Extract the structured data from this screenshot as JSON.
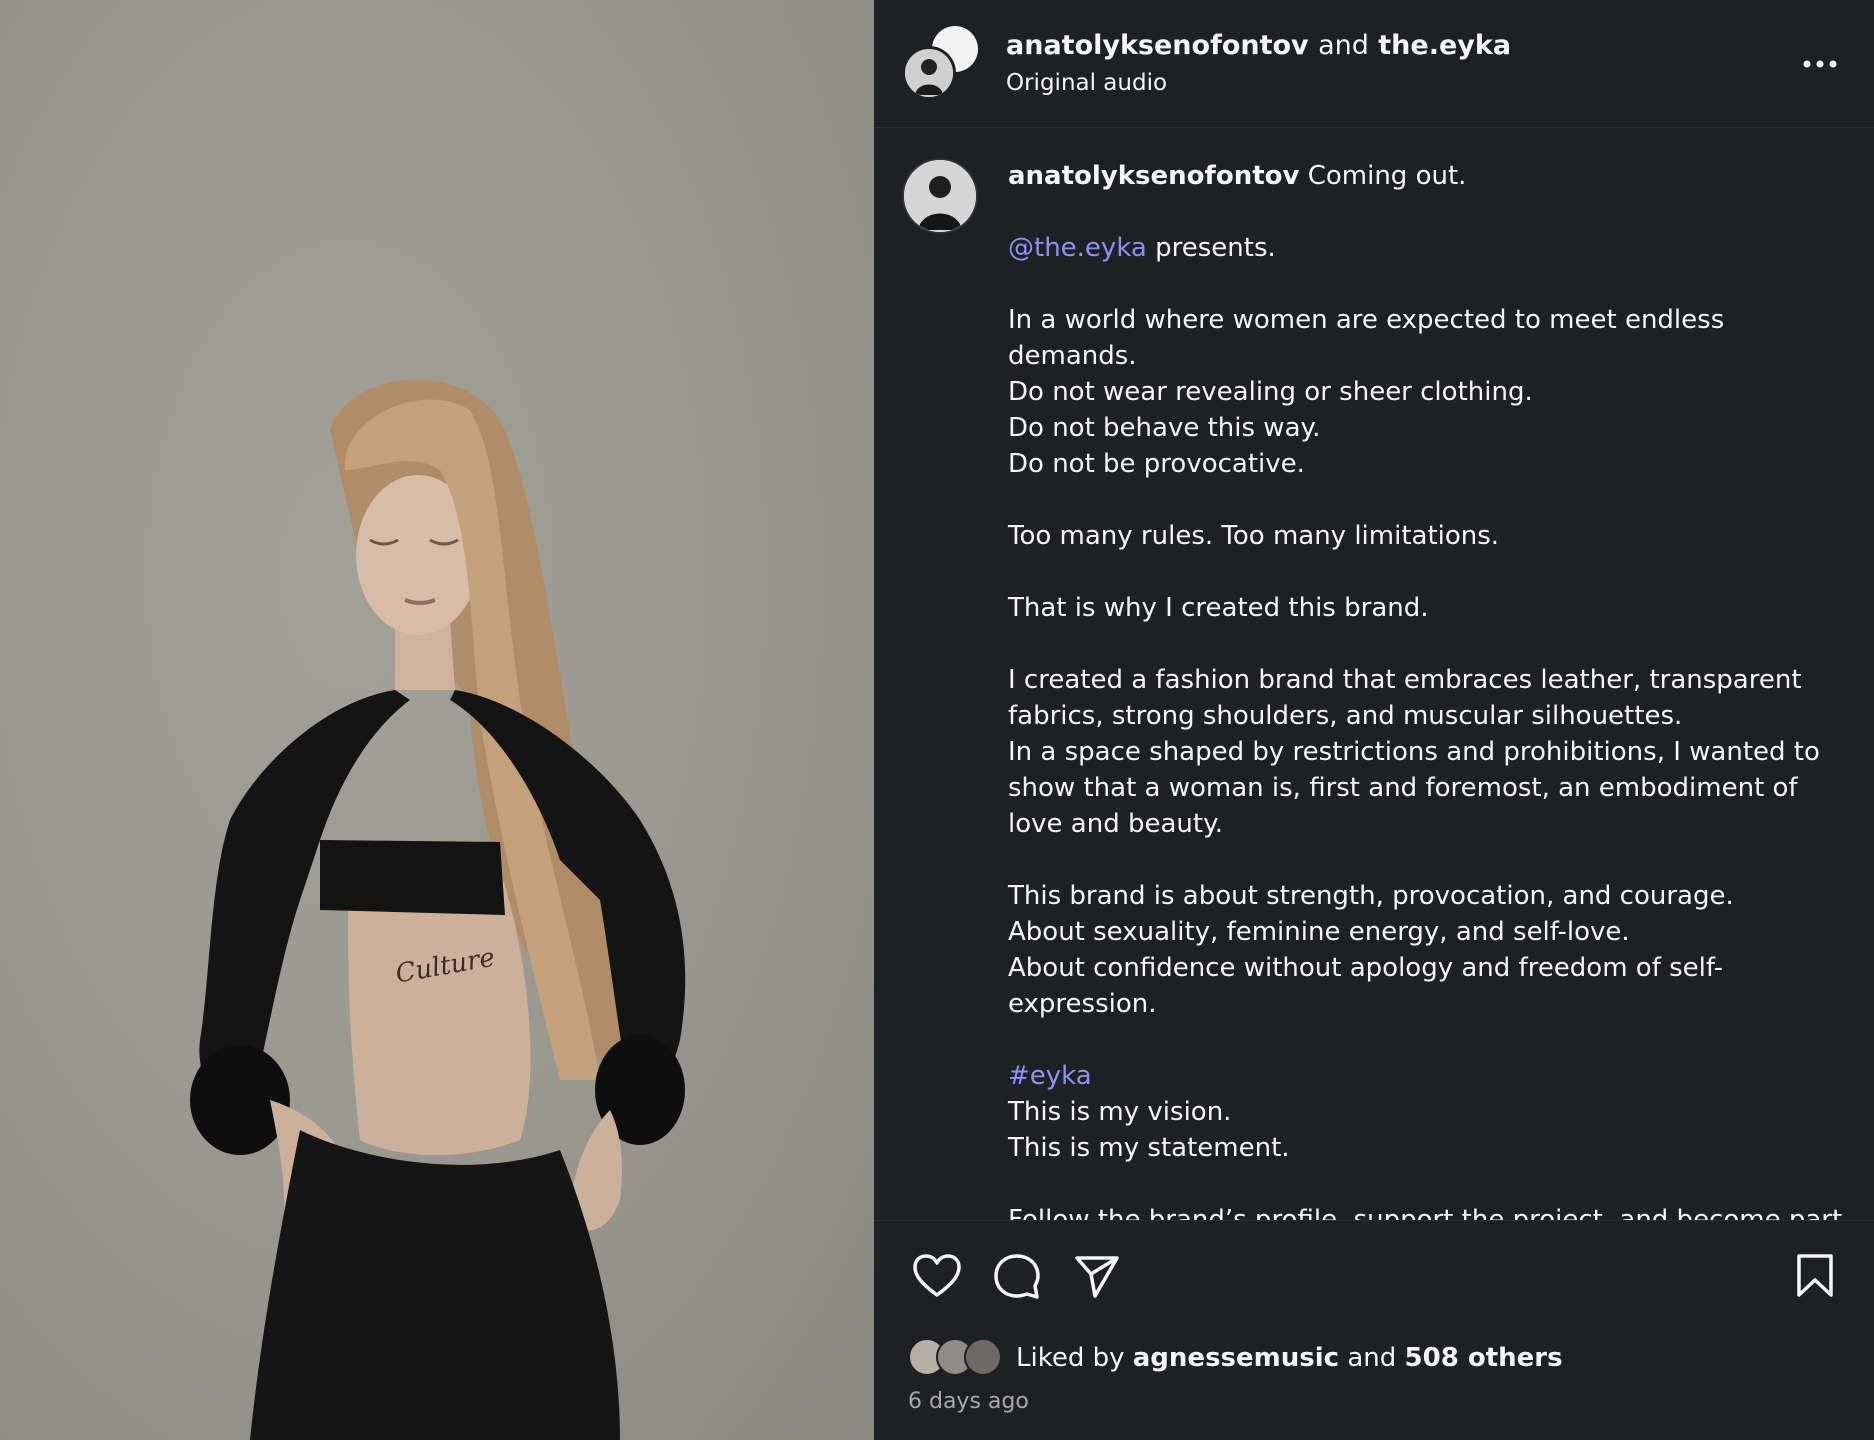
{
  "header": {
    "author1": "anatolyksenofontov",
    "and_word": "and",
    "author2": "the.eyka",
    "audio": "Original audio",
    "more_icon": "more-horizontal-icon"
  },
  "media": {
    "tattoo_text": "Culture"
  },
  "caption": {
    "username": "anatolyksenofontov",
    "intro": "Coming out.",
    "mention": "@the.eyka",
    "mention_tail": "presents.",
    "p1": [
      "In a world where women are expected to meet endless demands.",
      "Do not wear revealing or sheer clothing.",
      "Do not behave this way.",
      "Do not be provocative."
    ],
    "p2": "Too many rules. Too many limitations.",
    "p3": "That is why I created this brand.",
    "p4": "I created a fashion brand that embraces leather, transparent fabrics, strong shoulders, and muscular silhouettes.",
    "p4b": "In a space shaped by restrictions and prohibitions, I wanted to show that a woman is, first and foremost, an embodiment of love and beauty.",
    "p5": [
      "This brand is about strength, provocation, and courage.",
      "About sexuality, feminine energy, and self-love.",
      "About confidence without apology and freedom of self-expression."
    ],
    "hashtag": "#eyka",
    "p6": [
      "This is my vision.",
      "This is my statement."
    ],
    "p7": "Follow the brand’s profile, support the project, and become part of this story."
  },
  "actions": {
    "like_icon": "heart-icon",
    "comment_icon": "comment-icon",
    "share_icon": "send-icon",
    "save_icon": "bookmark-icon"
  },
  "likes": {
    "prefix": "Liked by",
    "user": "agnessemusic",
    "middle": "and",
    "others": "508 others"
  },
  "timestamp": "6 days ago",
  "colors": {
    "panel_bg": "#1f2024",
    "link": "#8a93f5",
    "text": "#f5f5f5",
    "muted": "#a8a8a8"
  }
}
